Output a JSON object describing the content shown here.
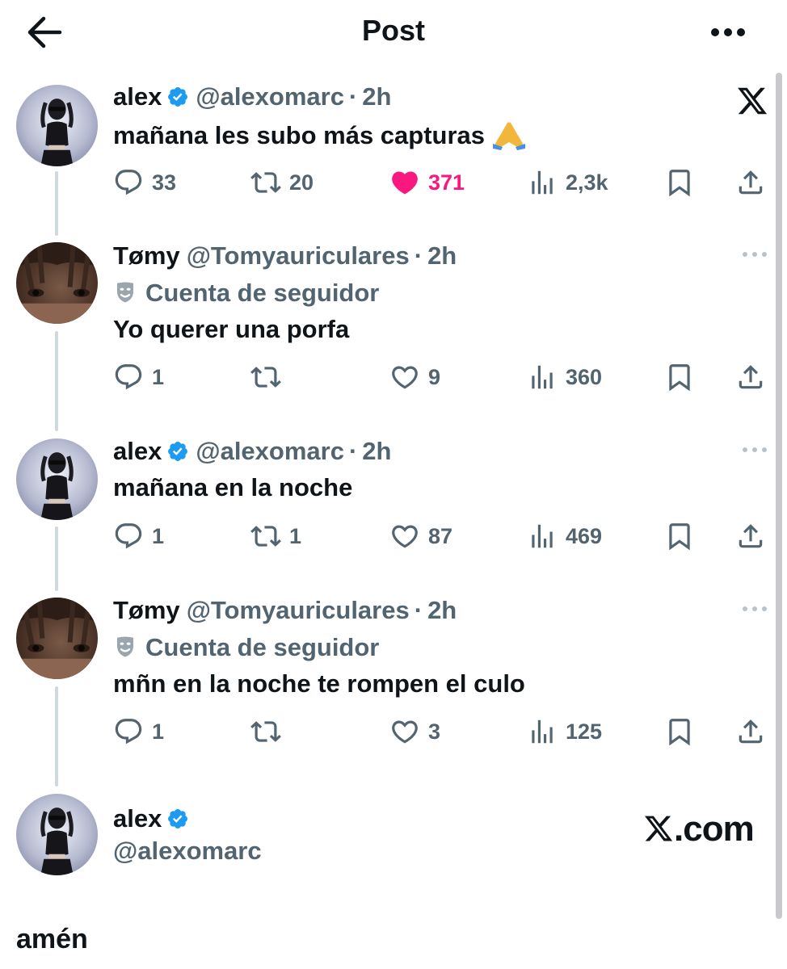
{
  "header": {
    "title": "Post",
    "back_icon": "arrow-left-icon",
    "more_icon": "more-horizontal-icon"
  },
  "colors": {
    "verified": "#1d9bf0",
    "like": "#f91880",
    "muted": "#536471",
    "text": "#0f1419",
    "thread_line": "#cfd9de"
  },
  "posts": [
    {
      "name": "alex",
      "verified": true,
      "handle": "@alexomarc",
      "dot": "·",
      "time": "2h",
      "text": "mañana les subo más capturas",
      "emoji": "folded-hands-icon",
      "corner": "x-logo-icon",
      "replies": "33",
      "reposts": "20",
      "likes": "371",
      "liked": true,
      "views": "2,3k"
    },
    {
      "name": "Tømy",
      "verified": false,
      "handle": "@Tomyauriculares",
      "dot": "·",
      "time": "2h",
      "subline": "Cuenta de seguidor",
      "subline_icon": "mask-icon",
      "text": "Yo querer una porfa",
      "replies": "1",
      "reposts": "",
      "likes": "9",
      "liked": false,
      "views": "360"
    },
    {
      "name": "alex",
      "verified": true,
      "handle": "@alexomarc",
      "dot": "·",
      "time": "2h",
      "text": "mañana en la noche",
      "replies": "1",
      "reposts": "1",
      "likes": "87",
      "liked": false,
      "views": "469"
    },
    {
      "name": "Tømy",
      "verified": false,
      "handle": "@Tomyauriculares",
      "dot": "·",
      "time": "2h",
      "subline": "Cuenta de seguidor",
      "subline_icon": "mask-icon",
      "text": "mñn en la noche te rompen el culo",
      "replies": "1",
      "reposts": "",
      "likes": "3",
      "liked": false,
      "views": "125"
    }
  ],
  "card": {
    "name": "alex",
    "handle": "@alexomarc",
    "brand": ".com"
  },
  "caption": "amén"
}
